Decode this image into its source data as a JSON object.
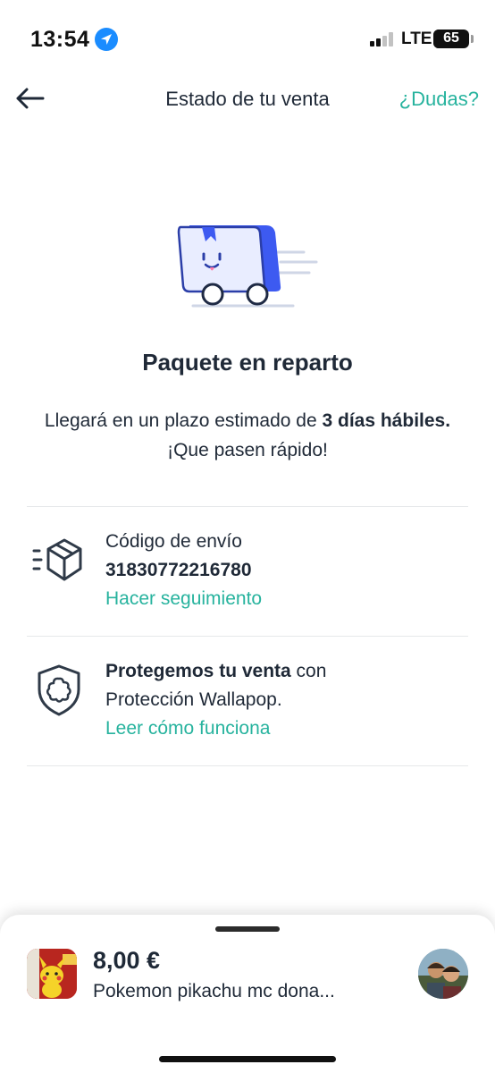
{
  "status_bar": {
    "time": "13:54",
    "network": "LTE",
    "battery": "65",
    "battery_level_percent": 65
  },
  "header": {
    "title": "Estado de tu venta",
    "help_label": "¿Dudas?"
  },
  "status": {
    "title": "Paquete en reparto",
    "desc_prefix": "Llegará en un plazo estimado de ",
    "desc_bold": "3 días hábiles.",
    "desc_suffix": " ¡Que pasen rápido!"
  },
  "shipping": {
    "label": "Código de envío",
    "code": "31830772216780",
    "link": "Hacer seguimiento"
  },
  "protection": {
    "bold": "Protegemos tu venta",
    "text_after_bold": " con",
    "text_line2": "Protección Wallapop.",
    "link": "Leer cómo funciona"
  },
  "product": {
    "price": "8,00 €",
    "name": "Pokemon pikachu mc dona..."
  },
  "colors": {
    "accent": "#27b39e",
    "illustration_blue": "#3d5af1",
    "text": "#1f2937"
  }
}
